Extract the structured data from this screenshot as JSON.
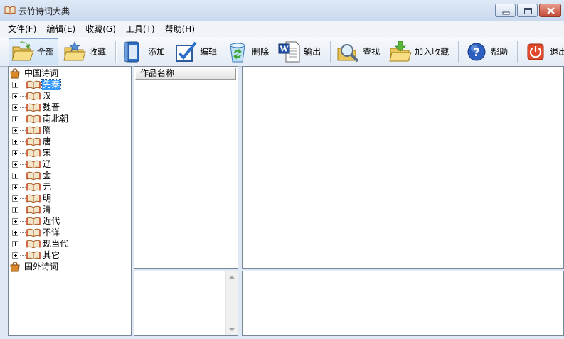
{
  "window": {
    "title": "云竹诗词大典"
  },
  "menu": [
    {
      "label": "文件(F)"
    },
    {
      "label": "编辑(E)"
    },
    {
      "label": "收藏(G)"
    },
    {
      "label": "工具(T)"
    },
    {
      "label": "帮助(H)"
    }
  ],
  "toolbar": {
    "all": "全部",
    "favorites": "收藏",
    "add": "添加",
    "edit": "编辑",
    "delete": "删除",
    "export": "输出",
    "search": "查找",
    "add_favorite": "加入收藏",
    "help": "帮助",
    "exit": "退出"
  },
  "tree": {
    "root_chinese": "中国诗词",
    "dynasties": [
      "先秦",
      "汉",
      "魏晋",
      "南北朝",
      "隋",
      "唐",
      "宋",
      "辽",
      "金",
      "元",
      "明",
      "清",
      "近代",
      "不详",
      "现当代",
      "其它"
    ],
    "selected": "先秦",
    "root_foreign": "国外诗词"
  },
  "works_list": {
    "header": "作品名称"
  },
  "colors": {
    "selection": "#3399ff",
    "window_bg": "#dfe9f5"
  }
}
